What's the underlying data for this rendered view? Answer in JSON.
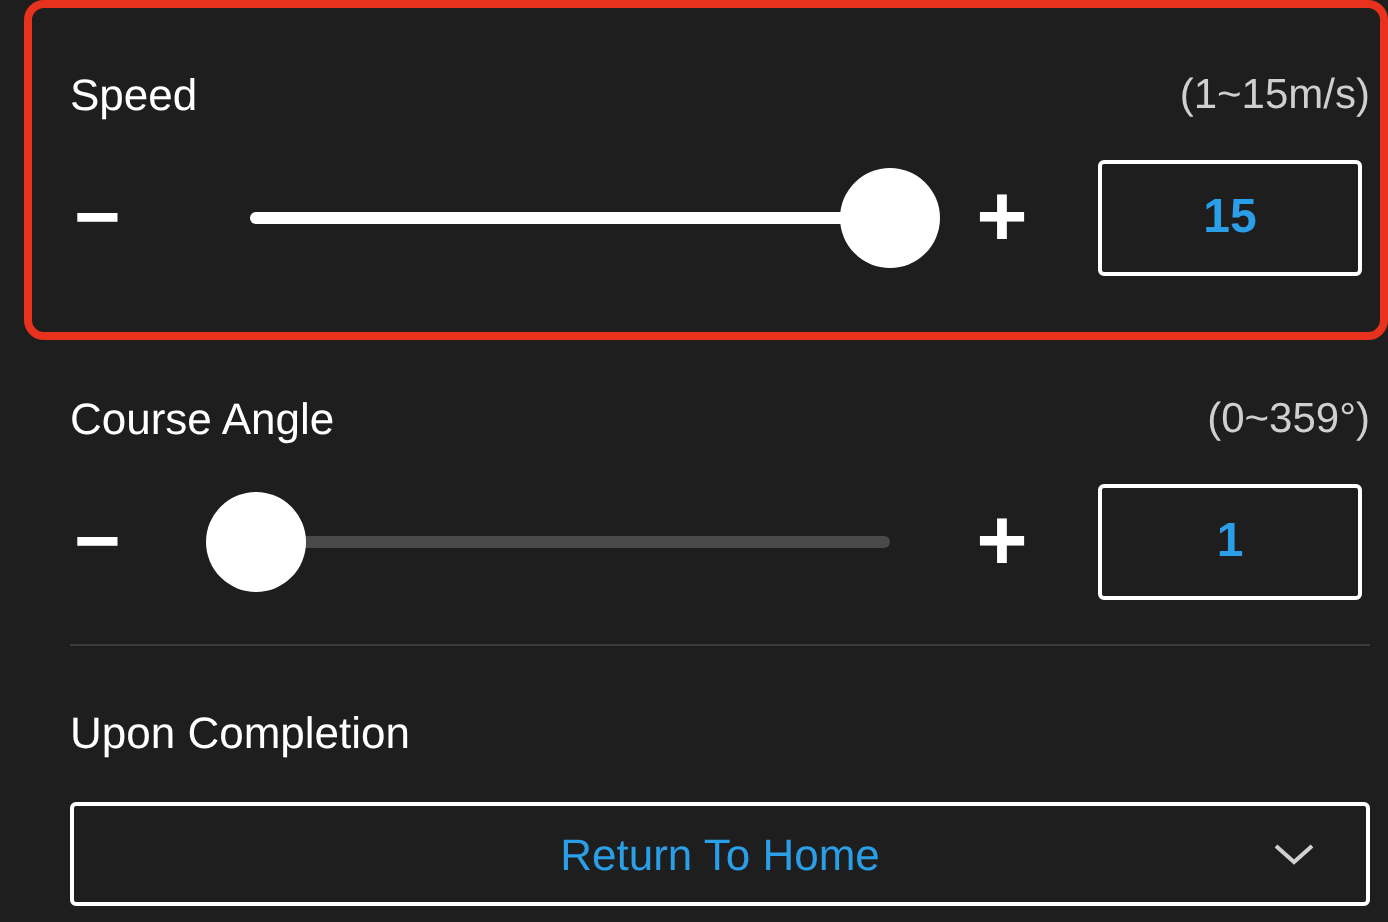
{
  "settings": [
    {
      "label": "Speed",
      "range": "(1~15m/s)",
      "minus": "−",
      "plus": "+",
      "value": "15",
      "level": 1,
      "highlighted": true
    },
    {
      "label": "Course Angle",
      "range": "(0~359°)",
      "minus": "−",
      "plus": "+",
      "value": "1",
      "level": 0.01
    }
  ],
  "upon_completion": {
    "label": "Upon Completion",
    "value": "Return To Home"
  }
}
